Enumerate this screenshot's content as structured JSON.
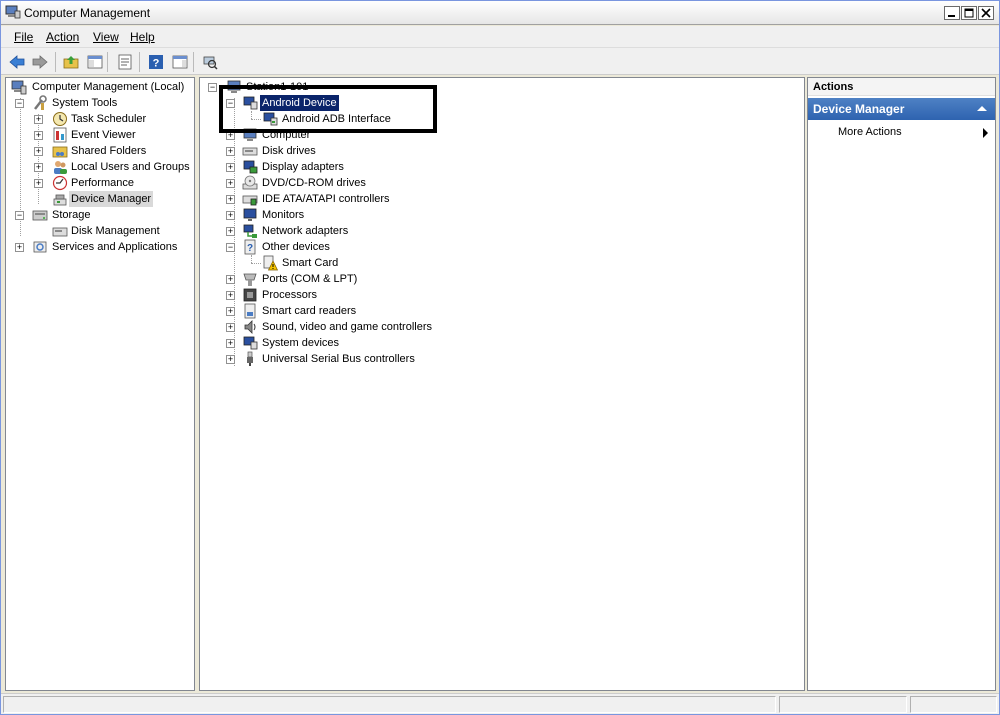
{
  "window": {
    "title": "Computer Management"
  },
  "menu": {
    "items": [
      "File",
      "Action",
      "View",
      "Help"
    ]
  },
  "toolbar": {
    "buttons": [
      "back-icon",
      "forward-icon",
      "up-icon",
      "show-hide-tree-icon",
      "properties-icon",
      "help-icon",
      "show-action-pane-icon",
      "scan-hardware-icon"
    ]
  },
  "left_tree": {
    "root": "Computer Management (Local)",
    "system_tools": "System Tools",
    "task_scheduler": "Task Scheduler",
    "event_viewer": "Event Viewer",
    "shared_folders": "Shared Folders",
    "local_users": "Local Users and Groups",
    "performance": "Performance",
    "device_manager": "Device Manager",
    "storage": "Storage",
    "disk_management": "Disk Management",
    "services": "Services and Applications"
  },
  "device_tree": {
    "root": "Station1-101",
    "android_device": "Android Device",
    "android_adb": "Android ADB Interface",
    "computer": "Computer",
    "disk_drives": "Disk drives",
    "display_adapters": "Display adapters",
    "dvd": "DVD/CD-ROM drives",
    "ide": "IDE ATA/ATAPI controllers",
    "monitors": "Monitors",
    "network_adapters": "Network adapters",
    "other_devices": "Other devices",
    "smart_card": "Smart Card",
    "ports": "Ports (COM & LPT)",
    "processors": "Processors",
    "smart_card_readers": "Smart card readers",
    "sound": "Sound, video and game controllers",
    "system_devices": "System devices",
    "usb": "Universal Serial Bus controllers"
  },
  "actions": {
    "title": "Actions",
    "section": "Device Manager",
    "more": "More Actions"
  },
  "colors": {
    "section_bg": "#2e63b0",
    "selected": "#0a246a",
    "annotation": "#000000"
  }
}
